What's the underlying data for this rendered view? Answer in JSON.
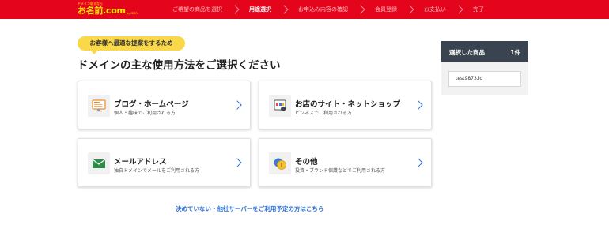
{
  "header": {
    "logo_tagline": "ドメイン取るなら",
    "logo_name": "お名前.com",
    "logo_sub": "by GMO",
    "steps": [
      {
        "label": "ご希望の商品を選択",
        "active": false
      },
      {
        "label": "用途選択",
        "active": true
      },
      {
        "label": "お申込み内容の確認",
        "active": false
      },
      {
        "label": "会員登録",
        "active": false
      },
      {
        "label": "お支払い",
        "active": false
      },
      {
        "label": "完了",
        "active": false
      }
    ],
    "colors": {
      "bar": "#e4051d",
      "logo": "#ffe900"
    }
  },
  "main": {
    "pill": "お客様へ最適な提案をするため",
    "heading": "ドメインの主な使用方法をご選択ください",
    "cards": [
      {
        "title": "ブログ・ホームページ",
        "desc": "個人・趣味でご利用される方",
        "icon": "monitor-icon"
      },
      {
        "title": "お店のサイト・ネットショップ",
        "desc": "ビジネスでご利用される方",
        "icon": "shop-icon"
      },
      {
        "title": "メールアドレス",
        "desc": "独自ドメインでメールをご利用される方",
        "icon": "mail-icon"
      },
      {
        "title": "その他",
        "desc": "投資・ブランド保護などでご利用される方",
        "icon": "coin-icon"
      }
    ],
    "link": "決めていない・他社サーバーをご利用予定の方はこちら",
    "link_color": "#2a6fd6"
  },
  "sidebar": {
    "title": "選択した商品",
    "count": "1件",
    "item": "test9873.io"
  }
}
